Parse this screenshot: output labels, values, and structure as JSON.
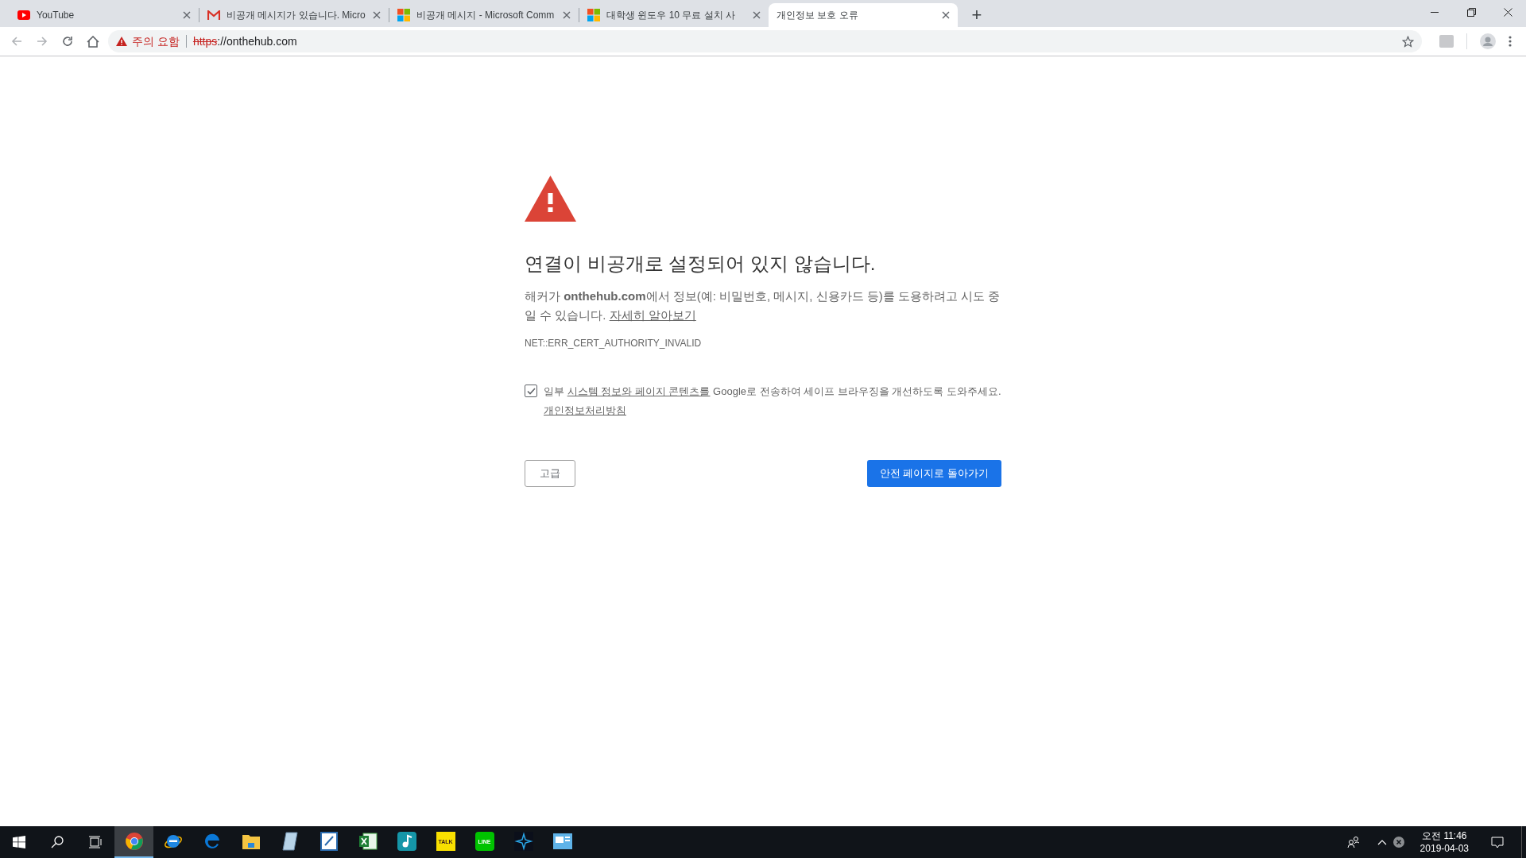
{
  "tabs": [
    {
      "title": "YouTube",
      "selected": false
    },
    {
      "title": "비공개 메시지가 있습니다. Micro",
      "selected": false
    },
    {
      "title": "비공개 메시지 - Microsoft Comm",
      "selected": false
    },
    {
      "title": "대학생 윈도우 10 무료 설치 사",
      "selected": false
    },
    {
      "title": "개인정보 보호 오류",
      "selected": true
    }
  ],
  "new_tab": "+",
  "address_bar": {
    "security_label": "주의 요함",
    "scheme": "https",
    "rest": "://onthehub.com"
  },
  "page": {
    "heading": "연결이 비공개로 설정되어 있지 않습니다.",
    "message": "해커가 **onthehub.com**에서 정보(예: 비밀번호, 메시지, 신용카드 등)를 도용하려고 시도 중일 수 있습니다.",
    "learn_more": "자세히 알아보기",
    "error_code": "NET::ERR_CERT_AUTHORITY_INVALID",
    "report": {
      "checked": true,
      "before": "일부",
      "link": "시스템 정보와 페이지 콘텐츠를",
      "middle": "Google로 전송하여 세이프 브라우징을 개선하도록 도와주세요.",
      "policy": "개인정보처리방침"
    },
    "advanced_button": "고급",
    "back_button": "안전 페이지로 돌아가기"
  },
  "taskbar": {
    "apps": [
      {
        "selected": true
      },
      {
        "selected": false
      },
      {
        "selected": false
      },
      {
        "selected": false
      },
      {
        "selected": false
      },
      {
        "selected": false
      },
      {
        "selected": false
      },
      {
        "selected": false
      },
      {
        "selected": false,
        "label": "TALK"
      },
      {
        "selected": false,
        "label": "LINE"
      },
      {
        "selected": false
      },
      {
        "selected": false
      }
    ],
    "time": "오전 11:46",
    "date": "2019-04-03"
  }
}
